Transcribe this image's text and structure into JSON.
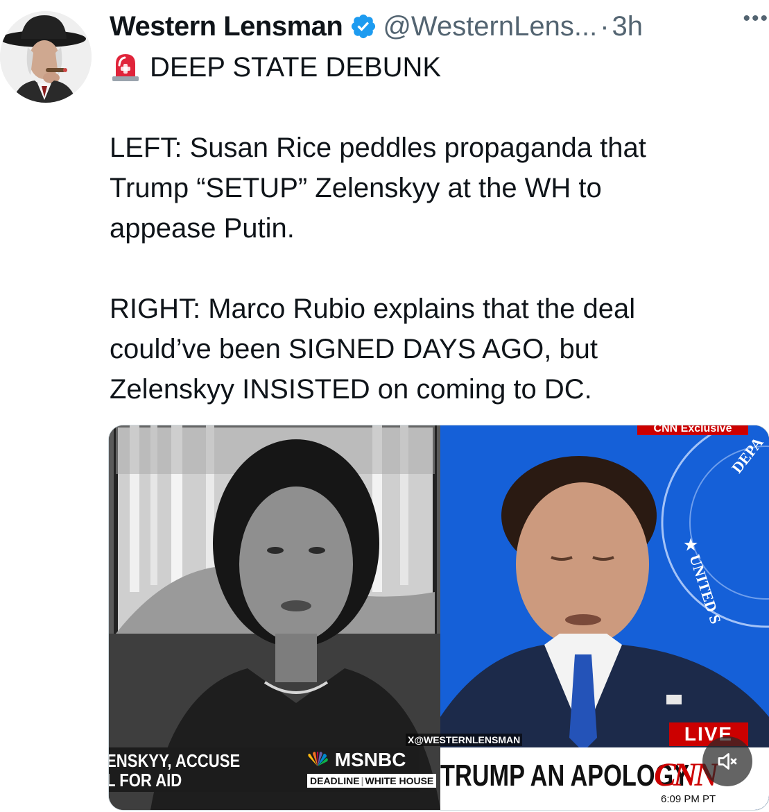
{
  "author": {
    "display_name": "Western Lensman",
    "handle": "@WesternLens...",
    "separator": "·",
    "timestamp": "3h",
    "verified": true
  },
  "more_menu_label": "•••",
  "tweet": {
    "line1": "DEEP STATE DEBUNK",
    "left_line1": "LEFT: Susan Rice peddles propaganda that",
    "left_line2": "Trump “SETUP” Zelenskyy at the WH to",
    "left_line3": "appease Putin.",
    "right_line1": "RIGHT: Marco Rubio explains that the deal",
    "right_line2": "could’ve been SIGNED DAYS AGO, but",
    "right_line3": "Zelenskyy INSISTED on coming to DC."
  },
  "media": {
    "left_chyron_line1": "ENSKYY, ACCUSE",
    "left_chyron_line2": "L FOR AID",
    "msnbc_logo": "MSNBC",
    "program_label_1": "DEADLINE",
    "program_label_2": "WHITE HOUSE",
    "watermark": "X@WESTERNLENSMAN",
    "cnn_exclusive": "CNN Exclusive",
    "live_badge": "LIVE",
    "cnn_headline": "TRUMP AN APOLOGY",
    "cnn_logo": "CNN",
    "cnn_time": "6:09 PM PT",
    "seal_text_1": "DEPA",
    "seal_text_2": "★ UNITED S"
  },
  "colors": {
    "verified_blue": "#1d9bf0",
    "text_primary": "#0f1419",
    "text_secondary": "#536471",
    "cnn_red": "#cc0000",
    "cnn_blue": "#1560d8"
  },
  "icons": {
    "siren": "rotating-light-icon",
    "verified": "verified-badge-icon",
    "mute": "speaker-muted-icon"
  }
}
